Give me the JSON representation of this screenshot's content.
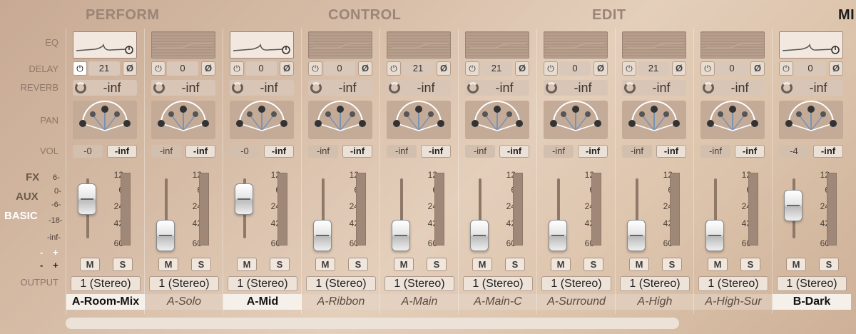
{
  "nav": {
    "perform": "PERFORM",
    "control": "CONTROL",
    "edit": "EDIT",
    "mix": "MI"
  },
  "row_labels": {
    "eq": "EQ",
    "delay": "DELAY",
    "reverb": "REVERB",
    "pan": "PAN",
    "vol": "VOL",
    "output": "OUTPUT"
  },
  "side": {
    "fx": "FX",
    "aux": "AUX",
    "basic": "BASIC",
    "minus": "-",
    "plus": "+"
  },
  "scale_ticks": [
    "12",
    "6",
    "24",
    "42",
    "60"
  ],
  "left_scale_ticks": [
    "6",
    "0",
    "-6",
    "-18",
    "-inf"
  ],
  "icons": {
    "power": "power-icon",
    "phase": "phase-invert-icon",
    "reverb_knob": "reverb-knob-icon"
  },
  "glyphs": {
    "power": "⏻",
    "phase": "Ø"
  },
  "channels": [
    {
      "name": "A-Room-Mix",
      "selected": true,
      "eq_active": true,
      "delay_on": true,
      "delay": "21",
      "reverb": "-inf",
      "vol_l": "-0",
      "vol_r": "-inf",
      "fader": 0.85,
      "mute": "M",
      "solo": "S",
      "output": "1 (Stereo)"
    },
    {
      "name": "A-Solo",
      "selected": false,
      "eq_active": false,
      "delay_on": false,
      "delay": "0",
      "reverb": "-inf",
      "vol_l": "-inf",
      "vol_r": "-inf",
      "fader": 0.0,
      "mute": "M",
      "solo": "S",
      "output": "1 (Stereo)"
    },
    {
      "name": "A-Mid",
      "selected": true,
      "eq_active": true,
      "delay_on": false,
      "delay": "0",
      "reverb": "-inf",
      "vol_l": "-0",
      "vol_r": "-inf",
      "fader": 0.85,
      "mute": "M",
      "solo": "S",
      "output": "1 (Stereo)"
    },
    {
      "name": "A-Ribbon",
      "selected": false,
      "eq_active": false,
      "delay_on": false,
      "delay": "0",
      "reverb": "-inf",
      "vol_l": "-inf",
      "vol_r": "-inf",
      "fader": 0.0,
      "mute": "M",
      "solo": "S",
      "output": "1 (Stereo)"
    },
    {
      "name": "A-Main",
      "selected": false,
      "eq_active": false,
      "delay_on": false,
      "delay": "21",
      "reverb": "-inf",
      "vol_l": "-inf",
      "vol_r": "-inf",
      "fader": 0.0,
      "mute": "M",
      "solo": "S",
      "output": "1 (Stereo)"
    },
    {
      "name": "A-Main-C",
      "selected": false,
      "eq_active": false,
      "delay_on": false,
      "delay": "21",
      "reverb": "-inf",
      "vol_l": "-inf",
      "vol_r": "-inf",
      "fader": 0.0,
      "mute": "M",
      "solo": "S",
      "output": "1 (Stereo)"
    },
    {
      "name": "A-Surround",
      "selected": false,
      "eq_active": false,
      "delay_on": false,
      "delay": "0",
      "reverb": "-inf",
      "vol_l": "-inf",
      "vol_r": "-inf",
      "fader": 0.0,
      "mute": "M",
      "solo": "S",
      "output": "1 (Stereo)"
    },
    {
      "name": "A-High",
      "selected": false,
      "eq_active": false,
      "delay_on": false,
      "delay": "21",
      "reverb": "-inf",
      "vol_l": "-inf",
      "vol_r": "-inf",
      "fader": 0.0,
      "mute": "M",
      "solo": "S",
      "output": "1 (Stereo)"
    },
    {
      "name": "A-High-Sur",
      "selected": false,
      "eq_active": false,
      "delay_on": false,
      "delay": "0",
      "reverb": "-inf",
      "vol_l": "-inf",
      "vol_r": "-inf",
      "fader": 0.0,
      "mute": "M",
      "solo": "S",
      "output": "1 (Stereo)"
    },
    {
      "name": "B-Dark",
      "selected": true,
      "eq_active": true,
      "delay_on": false,
      "delay": "0",
      "reverb": "-inf",
      "vol_l": "-4",
      "vol_r": "-inf",
      "fader": 0.7,
      "mute": "M",
      "solo": "S",
      "output": "1 (Stereo)"
    }
  ]
}
